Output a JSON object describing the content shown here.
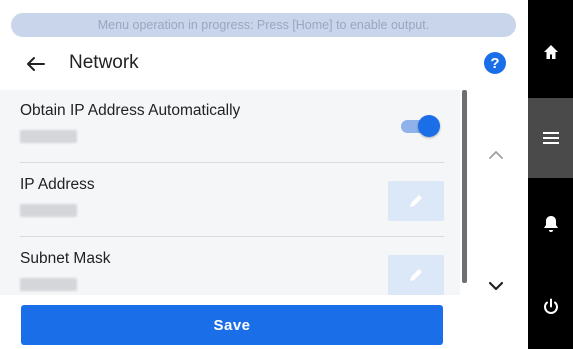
{
  "status_banner": {
    "text": "Menu operation in progress: Press [Home] to enable output."
  },
  "header": {
    "title": "Network",
    "help_label": "?"
  },
  "settings": [
    {
      "label": "Obtain IP Address Automatically",
      "control": "toggle",
      "enabled": true
    },
    {
      "label": "IP Address",
      "control": "edit"
    },
    {
      "label": "Subnet Mask",
      "control": "edit"
    }
  ],
  "save_button": {
    "label": "Save"
  },
  "side_nav": {
    "items": [
      "home-icon",
      "menu-icon",
      "notification-bell-icon",
      "power-icon"
    ],
    "active": "menu-icon"
  },
  "colors": {
    "accent": "#1a6fe8",
    "banner_bg": "#c9d5ea",
    "banner_text": "#98a7c2",
    "panel_bg": "#f5f6f8",
    "nav_bg": "#000000",
    "nav_active": "#4a4a4a"
  }
}
